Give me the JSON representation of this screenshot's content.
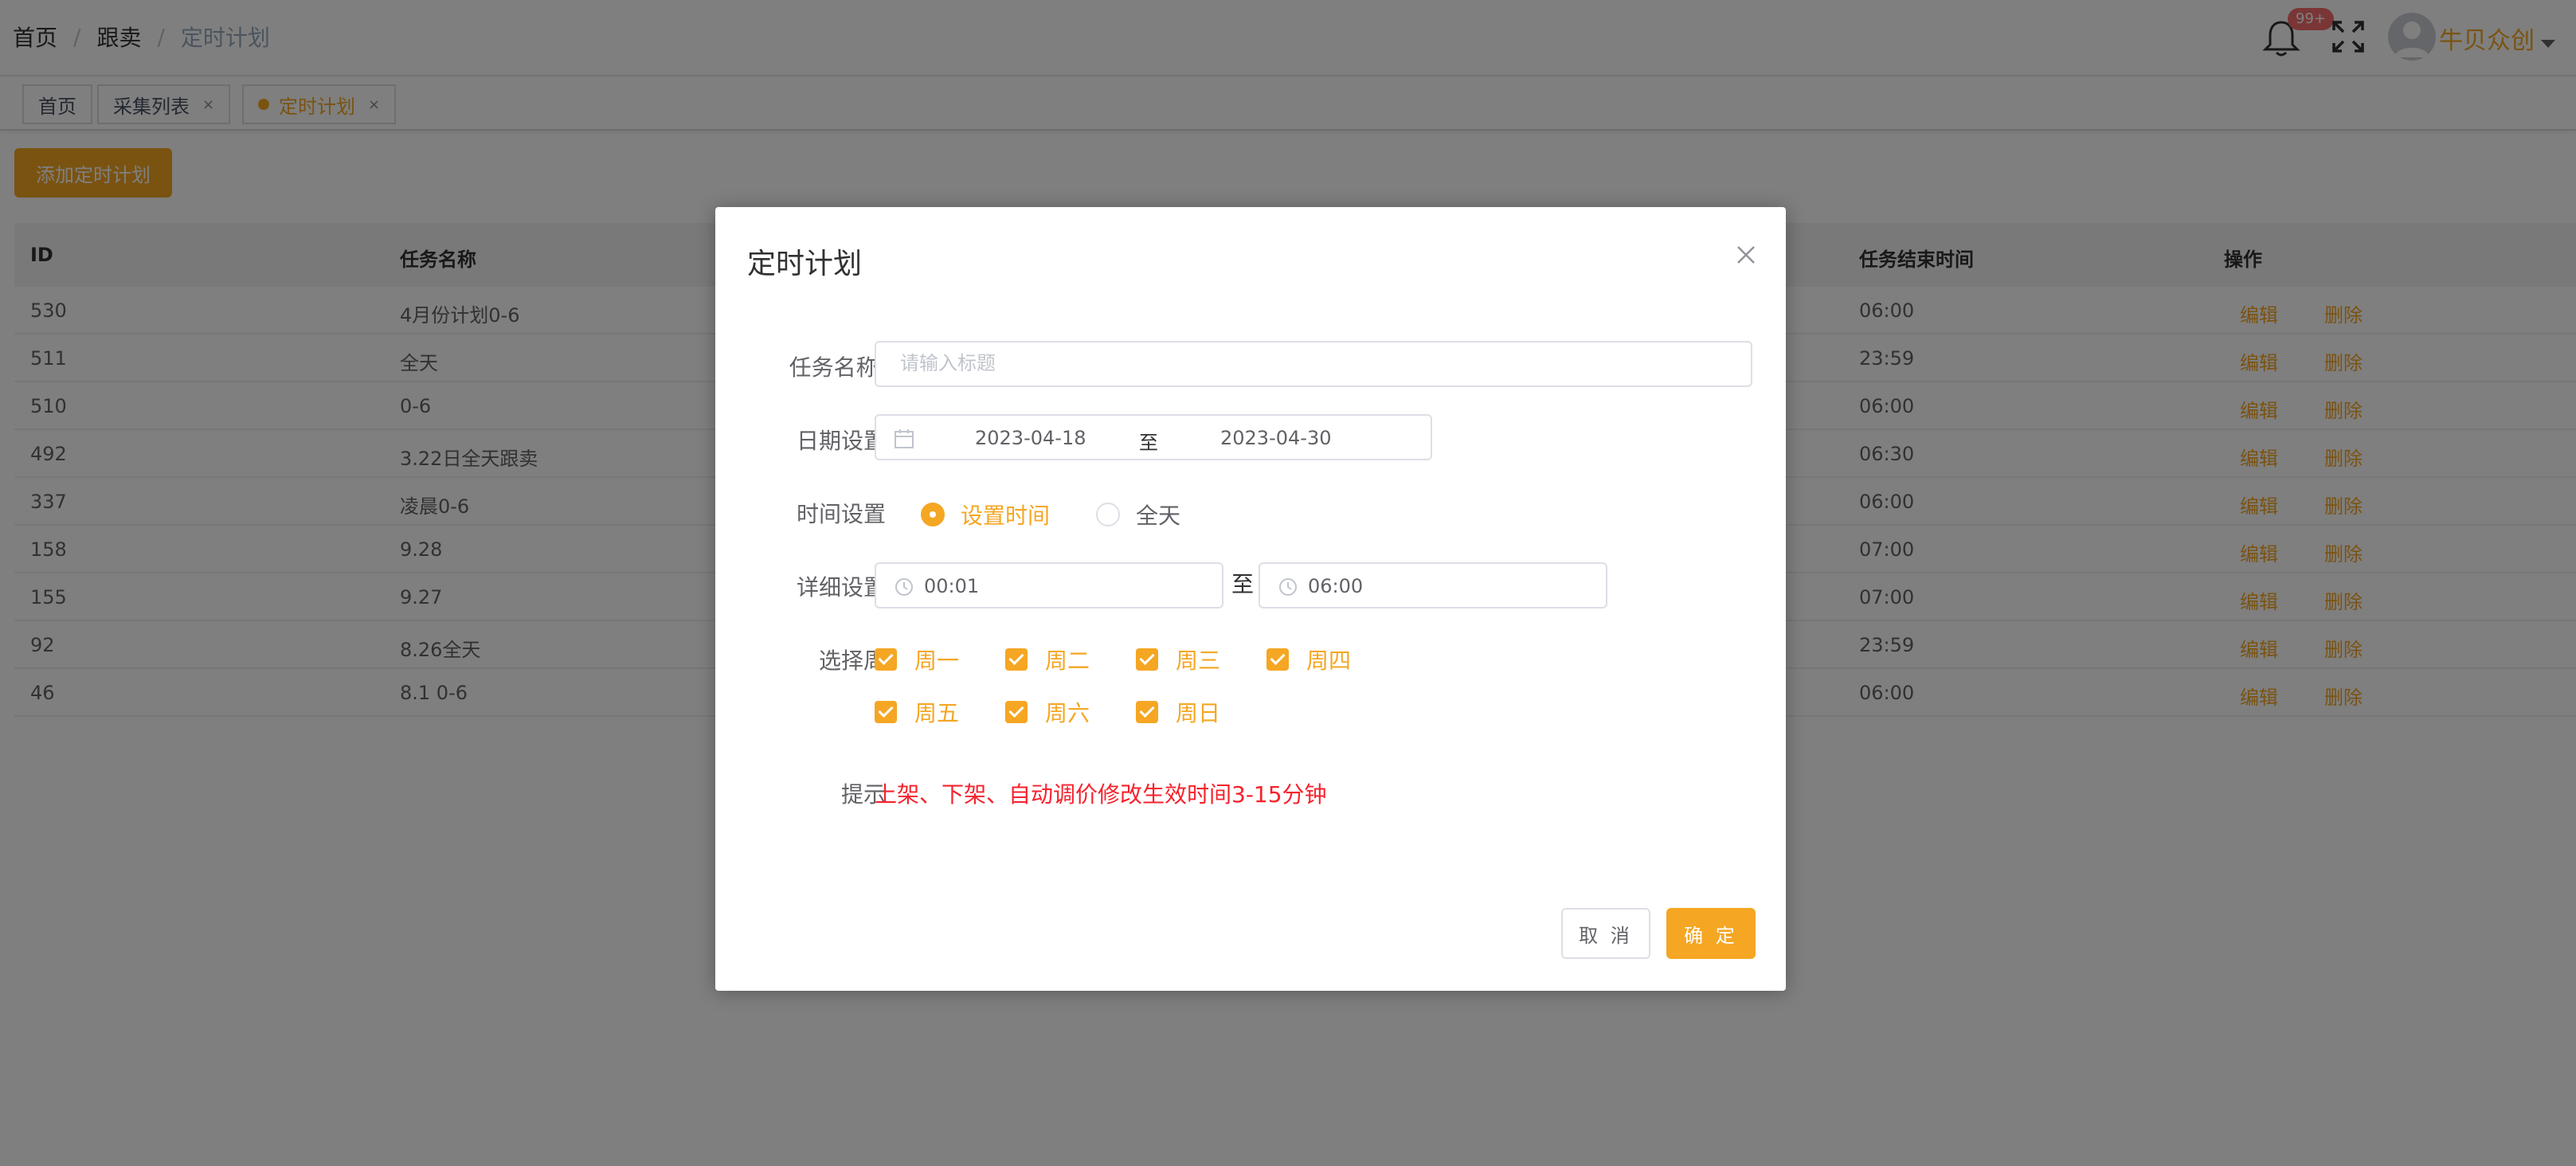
{
  "breadcrumb": [
    "首页",
    "跟卖",
    "定时计划"
  ],
  "header": {
    "notification_badge": "99+",
    "username": "牛贝众创",
    "accent_color": "#f5a623"
  },
  "tags": [
    {
      "label": "首页",
      "closable": false,
      "active": false
    },
    {
      "label": "采集列表",
      "closable": true,
      "active": false
    },
    {
      "label": "定时计划",
      "closable": true,
      "active": true
    }
  ],
  "tag_close_glyph": "×",
  "add_button": "添加定时计划",
  "table": {
    "columns": {
      "id": "ID",
      "name": "任务名称",
      "end_time": "任务结束时间",
      "ops": "操作"
    },
    "edit_label": "编辑",
    "delete_label": "删除",
    "rows": [
      {
        "id": "530",
        "name": "4月份计划0-6",
        "end": "06:00"
      },
      {
        "id": "511",
        "name": "全天",
        "end": "23:59"
      },
      {
        "id": "510",
        "name": "0-6",
        "end": "06:00"
      },
      {
        "id": "492",
        "name": "3.22日全天跟卖",
        "end": "06:30"
      },
      {
        "id": "337",
        "name": "凌晨0-6",
        "end": "06:00"
      },
      {
        "id": "158",
        "name": "9.28",
        "end": "07:00"
      },
      {
        "id": "155",
        "name": "9.27",
        "end": "07:00"
      },
      {
        "id": "92",
        "name": "8.26全天",
        "end": "23:59"
      },
      {
        "id": "46",
        "name": "8.1 0-6",
        "end": "06:00"
      }
    ]
  },
  "dialog": {
    "title": "定时计划",
    "task_name_label": "任务名称:",
    "task_name_placeholder": "请输入标题",
    "date_label": "日期设置",
    "date_start": "2023-04-18",
    "date_sep": "至",
    "date_end": "2023-04-30",
    "time_label": "时间设置",
    "time_options": [
      {
        "label": "设置时间",
        "checked": true
      },
      {
        "label": "全天",
        "checked": false
      }
    ],
    "detail_label": "详细设置",
    "time_start": "00:01",
    "time_sep": "至",
    "time_end": "06:00",
    "week_label": "选择周",
    "weekdays": [
      {
        "label": "周一",
        "checked": true
      },
      {
        "label": "周二",
        "checked": true
      },
      {
        "label": "周三",
        "checked": true
      },
      {
        "label": "周四",
        "checked": true
      },
      {
        "label": "周五",
        "checked": true
      },
      {
        "label": "周六",
        "checked": true
      },
      {
        "label": "周日",
        "checked": true
      }
    ],
    "hint_label": "提示",
    "hint_text": "上架、下架、自动调价修改生效时间3-15分钟",
    "cancel_label": "取 消",
    "confirm_label": "确 定"
  }
}
